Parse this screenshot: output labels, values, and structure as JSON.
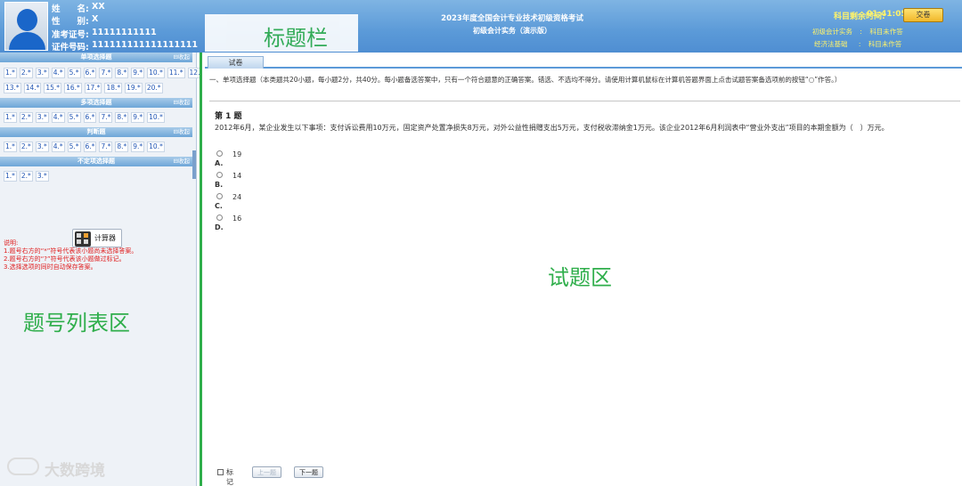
{
  "header": {
    "name_label": "姓　　名:",
    "name_value": "XX",
    "gender_label": "性　　别:",
    "gender_value": "X",
    "admission_label": "准考证号:",
    "admission_value": "11111111111",
    "id_label": "证件号码:",
    "id_value": "111111111111111111",
    "annotation": "标题栏",
    "exam_title": "2023年度全国会计专业技术初级资格考试",
    "exam_subtitle": "初级会计实务（演示版）",
    "time_label": "科目剩余时间:",
    "time_value": "01:41:05",
    "submit_label": "交卷",
    "subjects": [
      {
        "name": "初级会计实务",
        "status": "科目未作答"
      },
      {
        "name": "经济法基础",
        "status": "科目未作答"
      }
    ]
  },
  "sidebar": {
    "sections": [
      {
        "title": "单项选择题",
        "collapse": "收起",
        "rows": [
          [
            "1.*",
            "2.*",
            "3.*",
            "4.*",
            "5.*",
            "6.*",
            "7.*",
            "8.*",
            "9.*",
            "10.*",
            "11.*",
            "12.*"
          ],
          [
            "13.*",
            "14.*",
            "15.*",
            "16.*",
            "17.*",
            "18.*",
            "19.*",
            "20.*"
          ]
        ]
      },
      {
        "title": "多项选择题",
        "collapse": "收起",
        "rows": [
          [
            "1.*",
            "2.*",
            "3.*",
            "4.*",
            "5.*",
            "6.*",
            "7.*",
            "8.*",
            "9.*",
            "10.*"
          ]
        ]
      },
      {
        "title": "判断题",
        "collapse": "收起",
        "rows": [
          [
            "1.*",
            "2.*",
            "3.*",
            "4.*",
            "5.*",
            "6.*",
            "7.*",
            "8.*",
            "9.*",
            "10.*"
          ]
        ]
      },
      {
        "title": "不定项选择题",
        "collapse": "收起",
        "rows": [
          [
            "1.*",
            "2.*",
            "3.*"
          ]
        ]
      }
    ],
    "notes": [
      "说明:",
      "1.题号右方的“*”符号代表该小题尚未选择答案。",
      "2.题号右方的“?”符号代表该小题做过标记。",
      "3.选择选项的同时自动保存答案。"
    ],
    "calculator_label": "计算器",
    "annotation": "题号列表区",
    "watermark": "大数跨境"
  },
  "main": {
    "tab_label": "试卷",
    "instructions": "一、单项选择题（本类题共20小题，每小题2分，共40分。每小题备选答案中，只有一个符合题意的正确答案。错选、不选均不得分。请使用计算机鼠标在计算机答题界面上点击试题答案备选项前的按钮“○”作答。）",
    "question_number": "第 1 题",
    "question_text": "2012年6月，某企业发生以下事项：支付诉讼费用10万元，固定资产处置净损失8万元，对外公益性捐赠支出5万元，支付税收滞纳金1万元。该企业2012年6月利润表中“营业外支出”项目的本期金额为（　）万元。",
    "options": [
      {
        "letter": "A.",
        "value": "19"
      },
      {
        "letter": "B.",
        "value": "14"
      },
      {
        "letter": "C.",
        "value": "24"
      },
      {
        "letter": "D.",
        "value": "16"
      }
    ],
    "annotation": "试题区",
    "mark_label": "标记",
    "prev_label": "上一题",
    "next_label": "下一题"
  }
}
